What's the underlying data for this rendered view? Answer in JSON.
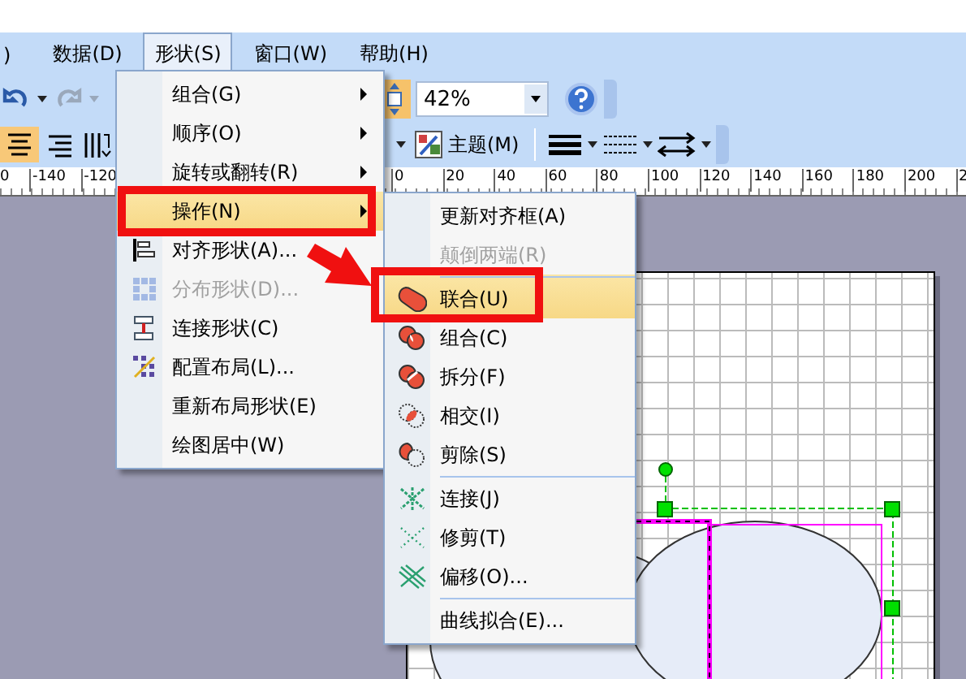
{
  "menubar": [
    {
      "label": ")",
      "selected": false
    },
    {
      "label": "数据(D)",
      "selected": false
    },
    {
      "label": "形状(S)",
      "selected": true
    },
    {
      "label": "窗口(W)",
      "selected": false
    },
    {
      "label": "帮助(H)",
      "selected": false
    }
  ],
  "toolbar": {
    "zoom": "42%",
    "theme_button": "主题(M)"
  },
  "ruler": {
    "left_labels": [
      "0",
      "-140",
      "-120"
    ],
    "right_labels": [
      "0",
      "20",
      "40",
      "60",
      "80",
      "100",
      "120",
      "140",
      "160",
      "180",
      "200",
      "2"
    ]
  },
  "shape_menu": {
    "items": [
      {
        "label": "组合(G)",
        "submenu": true,
        "disabled": false,
        "highlighted": false
      },
      {
        "label": "顺序(O)",
        "submenu": true,
        "disabled": false,
        "highlighted": false
      },
      {
        "label": "旋转或翻转(R)",
        "submenu": true,
        "disabled": false,
        "highlighted": false
      },
      {
        "label": "操作(N)",
        "submenu": true,
        "disabled": false,
        "highlighted": true
      },
      {
        "label": "对齐形状(A)...",
        "submenu": false,
        "disabled": false,
        "highlighted": false
      },
      {
        "label": "分布形状(D)...",
        "submenu": false,
        "disabled": true,
        "highlighted": false
      },
      {
        "label": "连接形状(C)",
        "submenu": false,
        "disabled": false,
        "highlighted": false
      },
      {
        "label": "配置布局(L)...",
        "submenu": false,
        "disabled": false,
        "highlighted": false
      },
      {
        "label": "重新布局形状(E)",
        "submenu": false,
        "disabled": false,
        "highlighted": false
      },
      {
        "label": "绘图居中(W)",
        "submenu": false,
        "disabled": false,
        "highlighted": false
      }
    ]
  },
  "operations_menu": {
    "items": [
      {
        "label": "更新对齐框(A)",
        "disabled": false,
        "highlighted": false,
        "separator_before": false
      },
      {
        "label": "颠倒两端(R)",
        "disabled": true,
        "highlighted": false,
        "separator_before": false
      },
      {
        "label": "联合(U)",
        "disabled": false,
        "highlighted": true,
        "separator_before": true
      },
      {
        "label": "组合(C)",
        "disabled": false,
        "highlighted": false,
        "separator_before": false
      },
      {
        "label": "拆分(F)",
        "disabled": false,
        "highlighted": false,
        "separator_before": false
      },
      {
        "label": "相交(I)",
        "disabled": false,
        "highlighted": false,
        "separator_before": false
      },
      {
        "label": "剪除(S)",
        "disabled": false,
        "highlighted": false,
        "separator_before": false
      },
      {
        "label": "连接(J)",
        "disabled": false,
        "highlighted": false,
        "separator_before": true
      },
      {
        "label": "修剪(T)",
        "disabled": false,
        "highlighted": false,
        "separator_before": false
      },
      {
        "label": "偏移(O)...",
        "disabled": false,
        "highlighted": false,
        "separator_before": false
      },
      {
        "label": "曲线拟合(E)...",
        "disabled": false,
        "highlighted": false,
        "separator_before": true
      }
    ]
  }
}
